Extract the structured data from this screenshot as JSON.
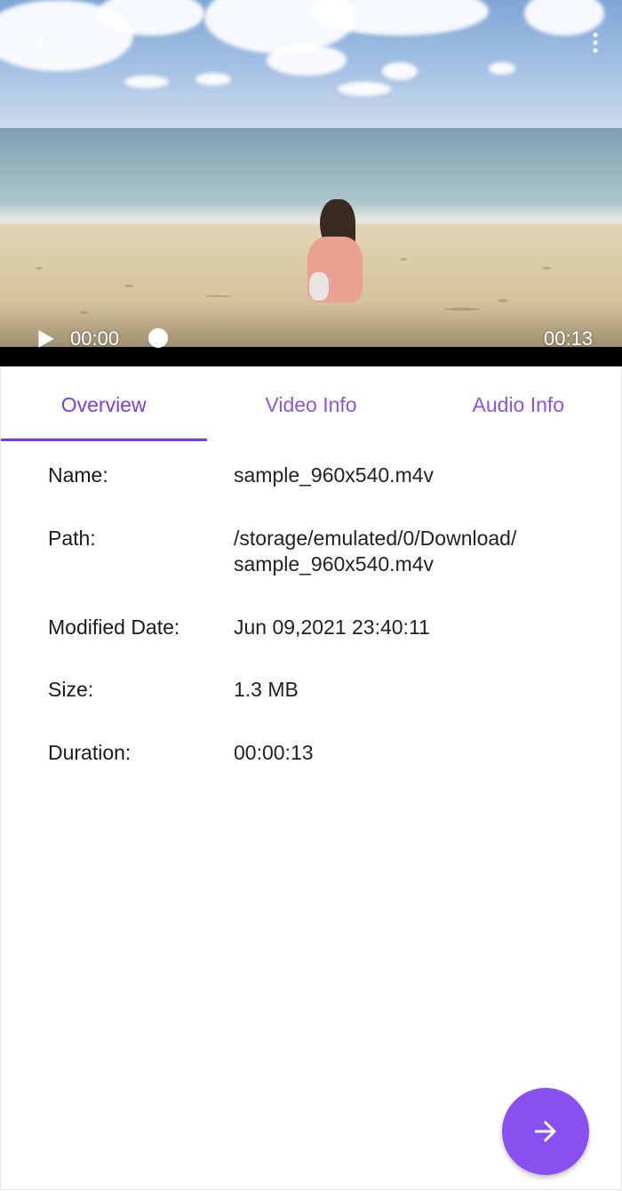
{
  "player": {
    "current_time": "00:00",
    "total_time": "00:13",
    "progress": 0.0,
    "icons": {
      "back": "arrow-left-icon",
      "more": "more-vert-icon",
      "play": "play-icon"
    }
  },
  "tabs": [
    {
      "label": "Overview",
      "active": true
    },
    {
      "label": "Video Info",
      "active": false
    },
    {
      "label": "Audio Info",
      "active": false
    }
  ],
  "overview": {
    "name_label": "Name:",
    "name_value": "sample_960x540.m4v",
    "path_label": "Path:",
    "path_value": "/storage/emulated/0/Download/ sample_960x540.m4v",
    "modified_label": "Modified Date:",
    "modified_value": "Jun 09,2021 23:40:11",
    "size_label": "Size:",
    "size_value": "1.3 MB",
    "duration_label": "Duration:",
    "duration_value": "00:00:13"
  },
  "fab": {
    "icon": "arrow-right-icon"
  },
  "colors": {
    "accent": "#7b3be4",
    "tab_text": "#8b55e0",
    "fab": "#8a4ff0"
  }
}
